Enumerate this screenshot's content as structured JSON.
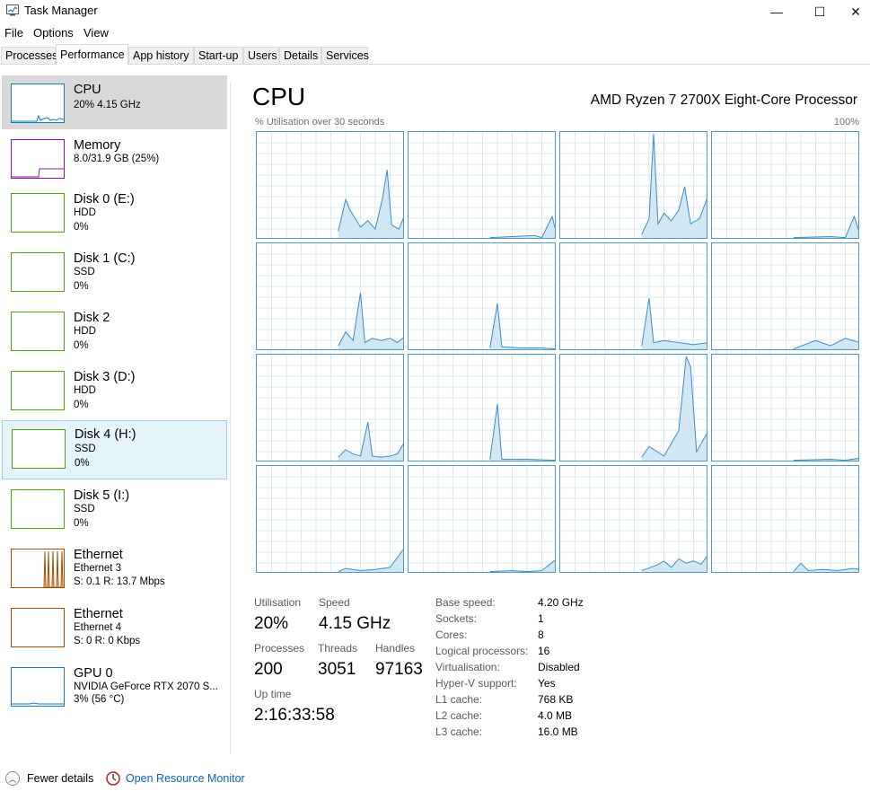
{
  "window": {
    "title": "Task Manager",
    "minimize": "—",
    "maximize": "☐",
    "close": "✕"
  },
  "menu": [
    "File",
    "Options",
    "View"
  ],
  "tabs": [
    "Processes",
    "Performance",
    "App history",
    "Start-up",
    "Users",
    "Details",
    "Services"
  ],
  "sidebar": [
    {
      "title": "CPU",
      "sub1": "20%  4.15 GHz",
      "sub2": "",
      "sub3": "",
      "color": "#117dbb"
    },
    {
      "title": "Memory",
      "sub1": "8.0/31.9 GB (25%)",
      "sub2": "",
      "sub3": "",
      "color": "#8b12ae"
    },
    {
      "title": "Disk 0 (E:)",
      "sub1": "HDD",
      "sub2": "0%",
      "sub3": "",
      "color": "#4da60c"
    },
    {
      "title": "Disk 1 (C:)",
      "sub1": "SSD",
      "sub2": "0%",
      "sub3": "",
      "color": "#4da60c"
    },
    {
      "title": "Disk 2",
      "sub1": "HDD",
      "sub2": "0%",
      "sub3": "",
      "color": "#4da60c"
    },
    {
      "title": "Disk 3 (D:)",
      "sub1": "HDD",
      "sub2": "0%",
      "sub3": "",
      "color": "#4da60c"
    },
    {
      "title": "Disk 4 (H:)",
      "sub1": "SSD",
      "sub2": "0%",
      "sub3": "",
      "color": "#4da60c"
    },
    {
      "title": "Disk 5 (I:)",
      "sub1": "SSD",
      "sub2": "0%",
      "sub3": "",
      "color": "#4da60c"
    },
    {
      "title": "Ethernet",
      "sub1": "Ethernet 3",
      "sub2": "S: 0.1  R: 13.7 Mbps",
      "sub3": "",
      "color": "#a74f01"
    },
    {
      "title": "Ethernet",
      "sub1": "Ethernet 4",
      "sub2": "S: 0  R: 0 Kbps",
      "sub3": "",
      "color": "#a74f01"
    },
    {
      "title": "GPU 0",
      "sub1": "NVIDIA GeForce RTX 2070 S...",
      "sub2": "3%  (56 °C)",
      "sub3": "",
      "color": "#117dbb"
    }
  ],
  "main": {
    "title": "CPU",
    "processor": "AMD Ryzen 7 2700X Eight-Core Processor",
    "util_label": "% Utilisation over 30 seconds",
    "util_max": "100%"
  },
  "stats": {
    "utilisation_label": "Utilisation",
    "utilisation": "20%",
    "speed_label": "Speed",
    "speed": "4.15 GHz",
    "processes_label": "Processes",
    "processes": "200",
    "threads_label": "Threads",
    "threads": "3051",
    "handles_label": "Handles",
    "handles": "97163",
    "uptime_label": "Up time",
    "uptime": "2:16:33:58"
  },
  "details": [
    {
      "label": "Base speed:",
      "value": "4.20 GHz"
    },
    {
      "label": "Sockets:",
      "value": "1"
    },
    {
      "label": "Cores:",
      "value": "8"
    },
    {
      "label": "Logical processors:",
      "value": "16"
    },
    {
      "label": "Virtualisation:",
      "value": "Disabled"
    },
    {
      "label": "Hyper-V support:",
      "value": "Yes"
    },
    {
      "label": "L1 cache:",
      "value": "768 KB"
    },
    {
      "label": "L2 cache:",
      "value": "4.0 MB"
    },
    {
      "label": "L3 cache:",
      "value": "16.0 MB"
    }
  ],
  "footer": {
    "fewer_details": "Fewer details",
    "resource_monitor": "Open Resource Monitor"
  },
  "chart_data": {
    "type": "area",
    "ylim": [
      0,
      100
    ],
    "grid": true,
    "series": [
      {
        "values": [
          0,
          0,
          0,
          0,
          0,
          0,
          0,
          0,
          0,
          0,
          0,
          0,
          0,
          0,
          0,
          0,
          0,
          0,
          0,
          0,
          0,
          0,
          0,
          0,
          0,
          0,
          0,
          0,
          0,
          0,
          0,
          0,
          0,
          0,
          0,
          0,
          0,
          0,
          0,
          0,
          0,
          0,
          0,
          0,
          0,
          0,
          0,
          0,
          0,
          0,
          0,
          0,
          0,
          0,
          0,
          0,
          0,
          0,
          0,
          0,
          0,
          0,
          0,
          0,
          0,
          0,
          0,
          0,
          0,
          0,
          0,
          0,
          0,
          0,
          0,
          0,
          0,
          0,
          0,
          0,
          0,
          0,
          0,
          0,
          0,
          0,
          0,
          0,
          0,
          0,
          0,
          0,
          0,
          0,
          0,
          0,
          0,
          0,
          0,
          0,
          0,
          0,
          0,
          0,
          0,
          0,
          0,
          0,
          0,
          0,
          0,
          0,
          0,
          0,
          0,
          0,
          0,
          0,
          0,
          0,
          0,
          0,
          0,
          0,
          0,
          0,
          0,
          0,
          0,
          0,
          0,
          0,
          0,
          0,
          0,
          0,
          0,
          0,
          0,
          0,
          0,
          0,
          0,
          0,
          0,
          0,
          0,
          0,
          0,
          0,
          0,
          0,
          0,
          0,
          0,
          0,
          0,
          0,
          0,
          0,
          0,
          0,
          0,
          0,
          0,
          0,
          0,
          0,
          0
        ]
      },
      {
        "values": [
          0,
          0,
          0,
          0,
          0,
          0,
          0,
          0,
          0,
          0,
          0,
          0,
          0,
          0,
          0,
          0,
          0,
          0,
          0,
          0,
          0,
          0,
          0,
          0,
          0,
          0,
          0,
          0,
          0,
          0,
          0,
          0,
          0,
          0,
          0,
          0,
          0,
          0,
          0,
          0,
          0,
          0,
          0,
          0,
          0,
          0,
          0,
          0,
          0,
          0,
          0,
          0,
          0,
          0,
          0,
          0,
          0,
          0,
          0,
          0,
          0,
          0,
          0,
          0,
          0,
          0,
          0,
          0,
          0,
          0,
          0,
          0,
          0,
          0,
          0,
          0,
          0,
          0,
          0,
          0,
          0,
          0,
          0,
          0,
          0,
          0,
          0,
          0,
          0,
          0,
          0,
          0,
          0,
          0,
          0,
          0,
          0,
          0,
          0,
          0,
          0,
          0,
          0,
          0,
          0,
          0,
          0,
          0,
          0,
          0,
          0,
          0,
          0,
          0,
          0,
          0,
          0,
          0,
          0,
          0,
          0,
          0,
          0,
          0,
          0,
          0,
          0,
          0,
          0,
          0,
          0,
          0,
          0,
          0,
          0,
          0,
          0,
          0,
          0,
          0,
          0,
          0,
          0,
          0,
          0,
          0,
          0,
          0,
          0,
          0,
          0,
          0,
          0,
          0,
          0,
          0,
          0,
          0,
          0,
          0,
          0,
          0,
          0,
          0,
          0,
          0,
          0,
          0,
          0
        ]
      }
    ]
  }
}
